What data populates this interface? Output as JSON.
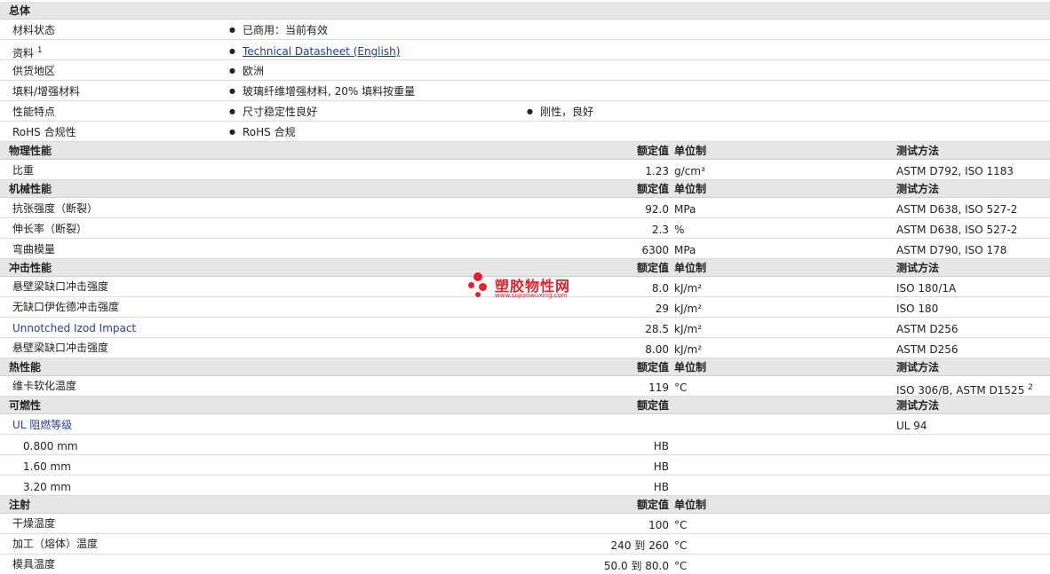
{
  "sections": {
    "general": "总体",
    "physical": "物理性能",
    "mechanical": "机械性能",
    "impact": "冲击性能",
    "thermal": "热性能",
    "flammability": "可燃性",
    "injection": "注射"
  },
  "headers": {
    "nominal": "额定值",
    "unit": "单位制",
    "method": "测试方法"
  },
  "general": {
    "status_label": "材料状态",
    "status_value": "已商用：当前有效",
    "docs_label": "资料",
    "docs_sup": "1",
    "docs_link": "Technical Datasheet (English)",
    "region_label": "供货地区",
    "region_value": "欧洲",
    "filler_label": "填料/增强材料",
    "filler_value": "玻璃纤维增强材料, 20% 填料按重量",
    "features_label": "性能特点",
    "feature1": "尺寸稳定性良好",
    "feature2": "刚性，良好",
    "rohs_label": "RoHS 合规性",
    "rohs_value": "RoHS 合规"
  },
  "physical": [
    {
      "name": "比重",
      "value": "1.23",
      "unit": "g/cm³",
      "method": "ASTM D792, ISO 1183"
    }
  ],
  "mechanical": [
    {
      "name": "抗张强度（断裂）",
      "value": "92.0",
      "unit": "MPa",
      "method": "ASTM D638, ISO 527-2"
    },
    {
      "name": "伸长率（断裂）",
      "value": "2.3",
      "unit": "%",
      "method": "ASTM D638, ISO 527-2"
    },
    {
      "name": "弯曲模量",
      "value": "6300",
      "unit": "MPa",
      "method": "ASTM D790, ISO 178"
    }
  ],
  "impact": [
    {
      "name": "悬壁梁缺口冲击强度",
      "value": "8.0",
      "unit": "kJ/m²",
      "method": "ISO 180/1A"
    },
    {
      "name": "无缺口伊佐德冲击强度",
      "value": "29",
      "unit": "kJ/m²",
      "method": "ISO 180"
    },
    {
      "name": "Unnotched Izod Impact",
      "value": "28.5",
      "unit": "kJ/m²",
      "method": "ASTM D256"
    },
    {
      "name": "悬壁梁缺口冲击强度",
      "value": "8.00",
      "unit": "kJ/m²",
      "method": "ASTM D256"
    }
  ],
  "thermal": [
    {
      "name": "维卡软化温度",
      "value": "119",
      "unit": "°C",
      "method": "ISO 306/B, ASTM D1525",
      "sup": "2"
    }
  ],
  "flammability": {
    "name": "UL 阻燃等级",
    "method": "UL 94",
    "rows": [
      {
        "name": "0.800 mm",
        "value": "HB"
      },
      {
        "name": "1.60 mm",
        "value": "HB"
      },
      {
        "name": "3.20 mm",
        "value": "HB"
      }
    ]
  },
  "injection": [
    {
      "name": "干燥温度",
      "value": "100",
      "unit": "°C"
    },
    {
      "name": "加工（熔体）温度",
      "value": "240 到 260",
      "unit": "°C"
    },
    {
      "name": "模具温度",
      "value": "50.0 到 80.0",
      "unit": "°C"
    }
  ],
  "watermark": {
    "text": "塑胶物性网",
    "url": "www.sujiaowuxing.com",
    "color": "#e8202a"
  }
}
